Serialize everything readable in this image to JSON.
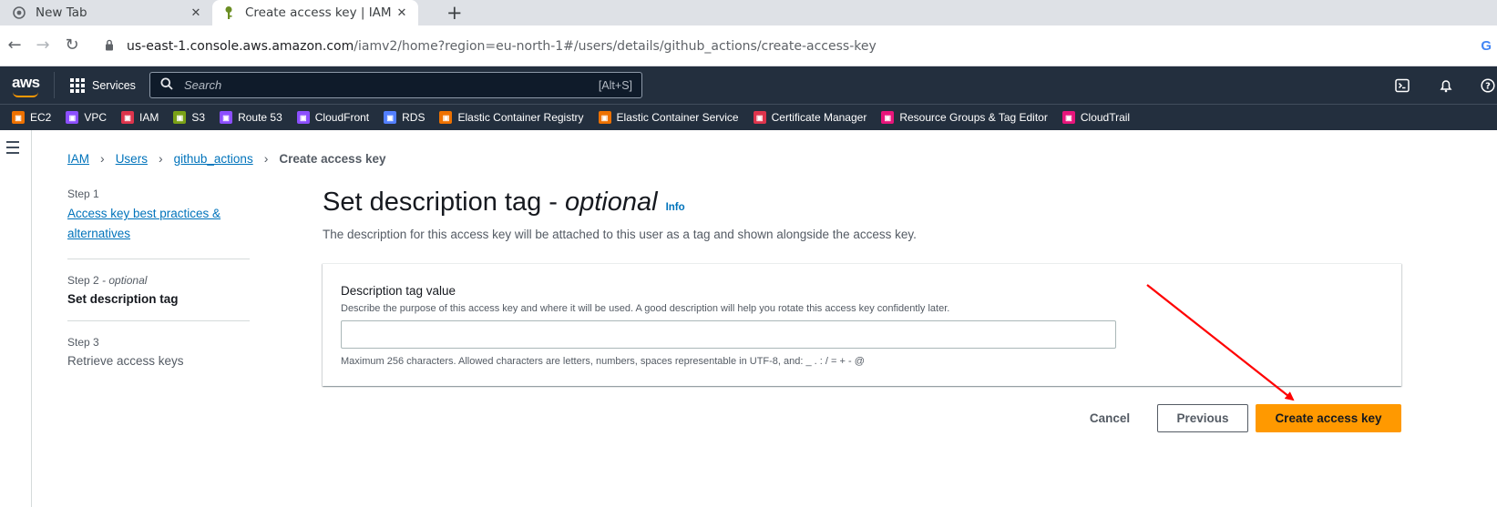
{
  "browser": {
    "tabs": [
      {
        "title": "New Tab",
        "close": "✕"
      },
      {
        "title": "Create access key | IAM | G",
        "close": "✕"
      }
    ],
    "new_tab": "+",
    "url_host": "us-east-1.console.aws.amazon.com",
    "url_path": "/iamv2/home?region=eu-north-1#/users/details/github_actions/create-access-key"
  },
  "aws_nav": {
    "logo": "aws",
    "services_label": "Services",
    "search_placeholder": "Search",
    "search_shortcut": "[Alt+S]"
  },
  "favorites": [
    {
      "label": "EC2",
      "color": "#ed7100"
    },
    {
      "label": "VPC",
      "color": "#8c4fff"
    },
    {
      "label": "IAM",
      "color": "#dd344c"
    },
    {
      "label": "S3",
      "color": "#7aa116"
    },
    {
      "label": "Route 53",
      "color": "#8c4fff"
    },
    {
      "label": "CloudFront",
      "color": "#8c4fff"
    },
    {
      "label": "RDS",
      "color": "#527fff"
    },
    {
      "label": "Elastic Container Registry",
      "color": "#ed7100"
    },
    {
      "label": "Elastic Container Service",
      "color": "#ed7100"
    },
    {
      "label": "Certificate Manager",
      "color": "#dd344c"
    },
    {
      "label": "Resource Groups & Tag Editor",
      "color": "#e7157b"
    },
    {
      "label": "CloudTrail",
      "color": "#e7157b"
    }
  ],
  "breadcrumb": {
    "items": [
      "IAM",
      "Users",
      "github_actions"
    ],
    "current": "Create access key"
  },
  "steps": {
    "s1_label": "Step 1",
    "s1_title": "Access key best practices & alternatives",
    "s2_label": "Step 2",
    "s2_optional": "- optional",
    "s2_title": "Set description tag",
    "s3_label": "Step 3",
    "s3_title": "Retrieve access keys"
  },
  "main": {
    "title": "Set description tag - ",
    "title_optional": "optional",
    "info": "Info",
    "subtitle": "The description for this access key will be attached to this user as a tag and shown alongside the access key.",
    "field_label": "Description tag value",
    "field_description": "Describe the purpose of this access key and where it will be used. A good description will help you rotate this access key confidently later.",
    "field_value": "",
    "field_constraint": "Maximum 256 characters. Allowed characters are letters, numbers, spaces representable in UTF-8, and: _ . : / = + - @"
  },
  "actions": {
    "cancel": "Cancel",
    "previous": "Previous",
    "create": "Create access key"
  },
  "colors": {
    "accent_orange": "#ff9900",
    "link_blue": "#0073bb",
    "annotation_arrow": "#ff0000"
  }
}
